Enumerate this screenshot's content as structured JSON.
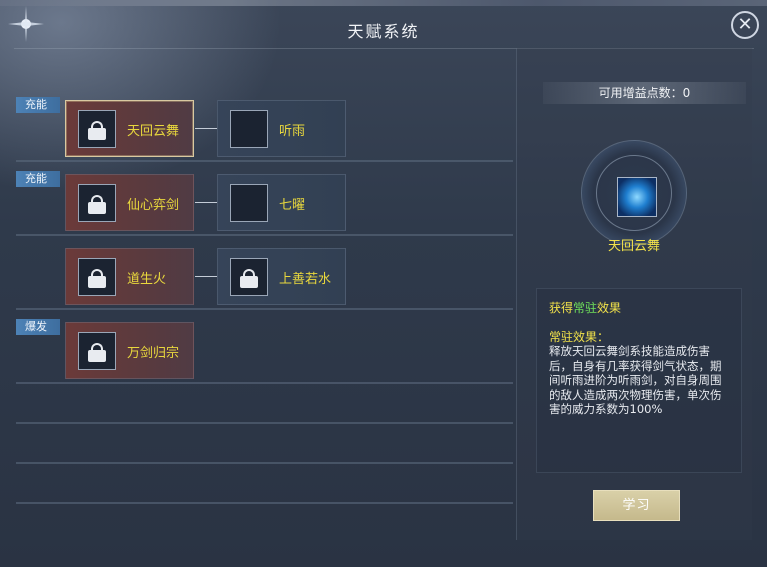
{
  "window": {
    "title": "天赋系统",
    "close_symbol": "✕"
  },
  "left": {
    "rows": [
      {
        "tag": "充能",
        "skills": [
          {
            "name": "天回云舞",
            "color": "red",
            "selected": true,
            "locked": true
          },
          {
            "name": "听雨",
            "color": "blue",
            "selected": false,
            "locked": false
          }
        ]
      },
      {
        "tag": "充能",
        "skills": [
          {
            "name": "仙心弈剑",
            "color": "red",
            "selected": false,
            "locked": true
          },
          {
            "name": "七曜",
            "color": "blue",
            "selected": false,
            "locked": false
          }
        ]
      },
      {
        "tag": "",
        "skills": [
          {
            "name": "道生火",
            "color": "red",
            "selected": false,
            "locked": true
          },
          {
            "name": "上善若水",
            "color": "blue",
            "selected": false,
            "locked": true
          }
        ]
      },
      {
        "tag": "爆发",
        "skills": [
          {
            "name": "万剑归宗",
            "color": "red",
            "selected": false,
            "locked": true
          }
        ]
      }
    ]
  },
  "right": {
    "points_label": "可用增益点数：0",
    "skill_title": "天回云舞",
    "desc_head_prefix": "获得",
    "desc_head_green": "常驻",
    "desc_head_suffix": "效果",
    "desc_label": "常驻效果：",
    "desc_text": "释放天回云舞剑系技能造成伤害后，自身有几率获得剑气状态，期间听雨进阶为听雨剑，对自身周围的敌人造成两次物理伤害，单次伤害的威力系数为100%",
    "learn_button": "学习"
  }
}
